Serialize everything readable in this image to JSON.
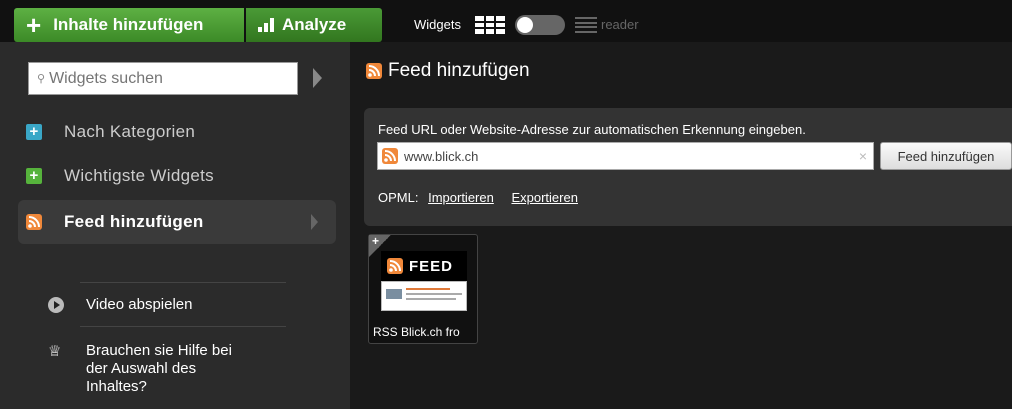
{
  "topbar": {
    "add_content_label": "Inhalte hinzufügen",
    "analyze_label": "Analyze",
    "widgets_label": "Widgets",
    "reader_label": "reader",
    "accent_color": "#4a9a36"
  },
  "sidebar": {
    "search_placeholder": "Widgets suchen",
    "items": [
      {
        "label": "Nach Kategorien",
        "icon": "plus-icon"
      },
      {
        "label": "Wichtigste Widgets",
        "icon": "plus-icon"
      },
      {
        "label": "Feed hinzufügen",
        "icon": "rss-icon",
        "active": true
      }
    ],
    "help": {
      "video_label": "Video abspielen",
      "help_line1": "Brauchen sie Hilfe bei",
      "help_line2": "der Auswahl des",
      "help_line3": "Inhaltes?"
    }
  },
  "main": {
    "title": "Feed hinzufügen",
    "instruction": "Feed URL oder Website-Adresse zur automatischen Erkennung eingeben.",
    "url_value": "www.blick.ch",
    "add_feed_button": "Feed hinzufügen",
    "opml_label": "OPML:",
    "import_label": "Importieren",
    "export_label": "Exportieren",
    "card": {
      "header_label": "FEED",
      "title": "RSS Blick.ch fro"
    }
  }
}
